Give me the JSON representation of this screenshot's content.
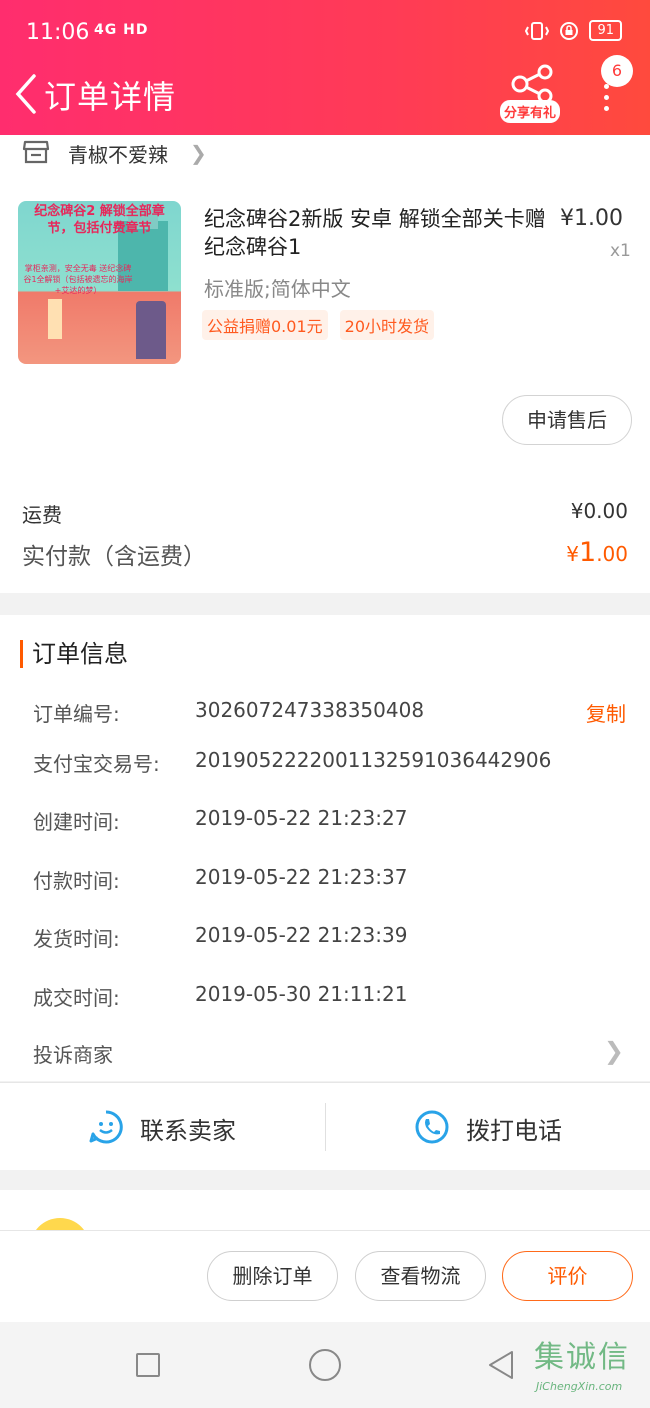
{
  "status_bar": {
    "time": "11:06",
    "network": "4G HD",
    "battery": "91"
  },
  "header": {
    "title": "订单详情",
    "share_label": "分享有礼",
    "badge_count": "6"
  },
  "store": {
    "name": "青椒不爱辣"
  },
  "item": {
    "title": "纪念碑谷2新版 安卓 解锁全部关卡赠纪念碑谷1",
    "price": "¥1.00",
    "quantity": "x1",
    "variant": "标准版;简体中文",
    "tags": [
      "公益捐赠0.01元",
      "20小时发货"
    ],
    "image_text_title": "纪念碑谷2 解锁全部章节，包括付费章节",
    "image_text_note": "掌柜亲测，安全无毒 送纪念碑谷1全解锁（包括被遗忘的海岸+艾达的梦）",
    "after_sale_label": "申请售后"
  },
  "summary": {
    "shipping_label": "运费",
    "shipping_value": "¥0.00",
    "paid_label": "实付款（含运费）",
    "paid_currency": "¥",
    "paid_int": "1",
    "paid_dec": ".00"
  },
  "order_info": {
    "heading": "订单信息",
    "copy_label": "复制",
    "rows": [
      {
        "label": "订单编号:",
        "value": "302607247338350408"
      },
      {
        "label": "支付宝交易号:",
        "value": "2019052222001132591036442906"
      },
      {
        "label": "创建时间:",
        "value": "2019-05-22 21:23:27"
      },
      {
        "label": "付款时间:",
        "value": "2019-05-22 21:23:37"
      },
      {
        "label": "发货时间:",
        "value": "2019-05-22 21:23:39"
      },
      {
        "label": "成交时间:",
        "value": "2019-05-30 21:11:21"
      }
    ],
    "complain_label": "投诉商家"
  },
  "contact": {
    "seller_label": "联系卖家",
    "call_label": "拨打电话"
  },
  "actions": {
    "delete_label": "删除订单",
    "logistics_label": "查看物流",
    "review_label": "评价"
  },
  "watermark": {
    "main": "集诚信",
    "sub": "JiChengXin.com"
  },
  "colors": {
    "header_start": "#ff2d6e",
    "header_end": "#ff4a3d",
    "accent": "#ff5a00",
    "contact_icon": "#29a3e8"
  }
}
